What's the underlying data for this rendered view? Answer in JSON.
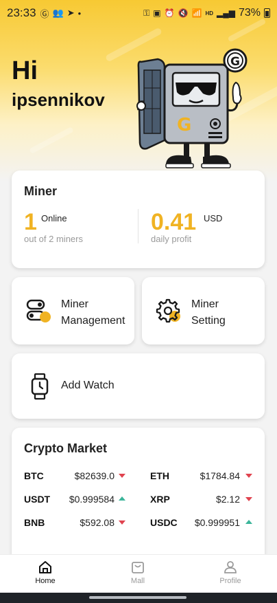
{
  "status_bar": {
    "time": "23:33",
    "battery": "73%",
    "network": "HD"
  },
  "greeting": {
    "hi": "Hi",
    "username": "ipsennikov"
  },
  "miner_card": {
    "title": "Miner",
    "online_count": "1",
    "online_label": "Online",
    "online_sub": "out of 2 miners",
    "profit_value": "0.41",
    "profit_unit": "USD",
    "profit_sub": "daily profit"
  },
  "tiles": {
    "management_line1": "Miner",
    "management_line2": "Management",
    "setting_line1": "Miner",
    "setting_line2": "Setting",
    "add_watch": "Add Watch"
  },
  "market": {
    "title": "Crypto Market",
    "rows": [
      {
        "left_symbol": "BTC",
        "left_price": "$82639.0",
        "left_trend": "down",
        "right_symbol": "ETH",
        "right_price": "$1784.84",
        "right_trend": "down"
      },
      {
        "left_symbol": "USDT",
        "left_price": "$0.999584",
        "left_trend": "up",
        "right_symbol": "XRP",
        "right_price": "$2.12",
        "right_trend": "down"
      },
      {
        "left_symbol": "BNB",
        "left_price": "$592.08",
        "left_trend": "down",
        "right_symbol": "USDC",
        "right_price": "$0.999951",
        "right_trend": "up"
      }
    ]
  },
  "nav": {
    "home": "Home",
    "mall": "Mall",
    "profile": "Profile",
    "active": "home"
  },
  "colors": {
    "accent": "#f0b323",
    "trend_down": "#e0434f",
    "trend_up": "#3bb59a"
  }
}
